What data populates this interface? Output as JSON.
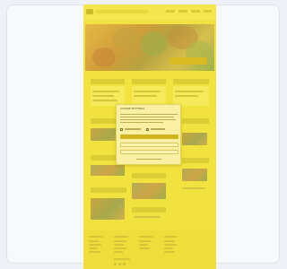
{
  "modal": {
    "title": "COOKIE SETTINGS"
  },
  "colors": {
    "background": "#eef1f6",
    "page_tint": "#f2e23f",
    "accent": "#d1b41f"
  },
  "icons": [
    "logo-icon",
    "checkbox-icon",
    "social-icon"
  ]
}
